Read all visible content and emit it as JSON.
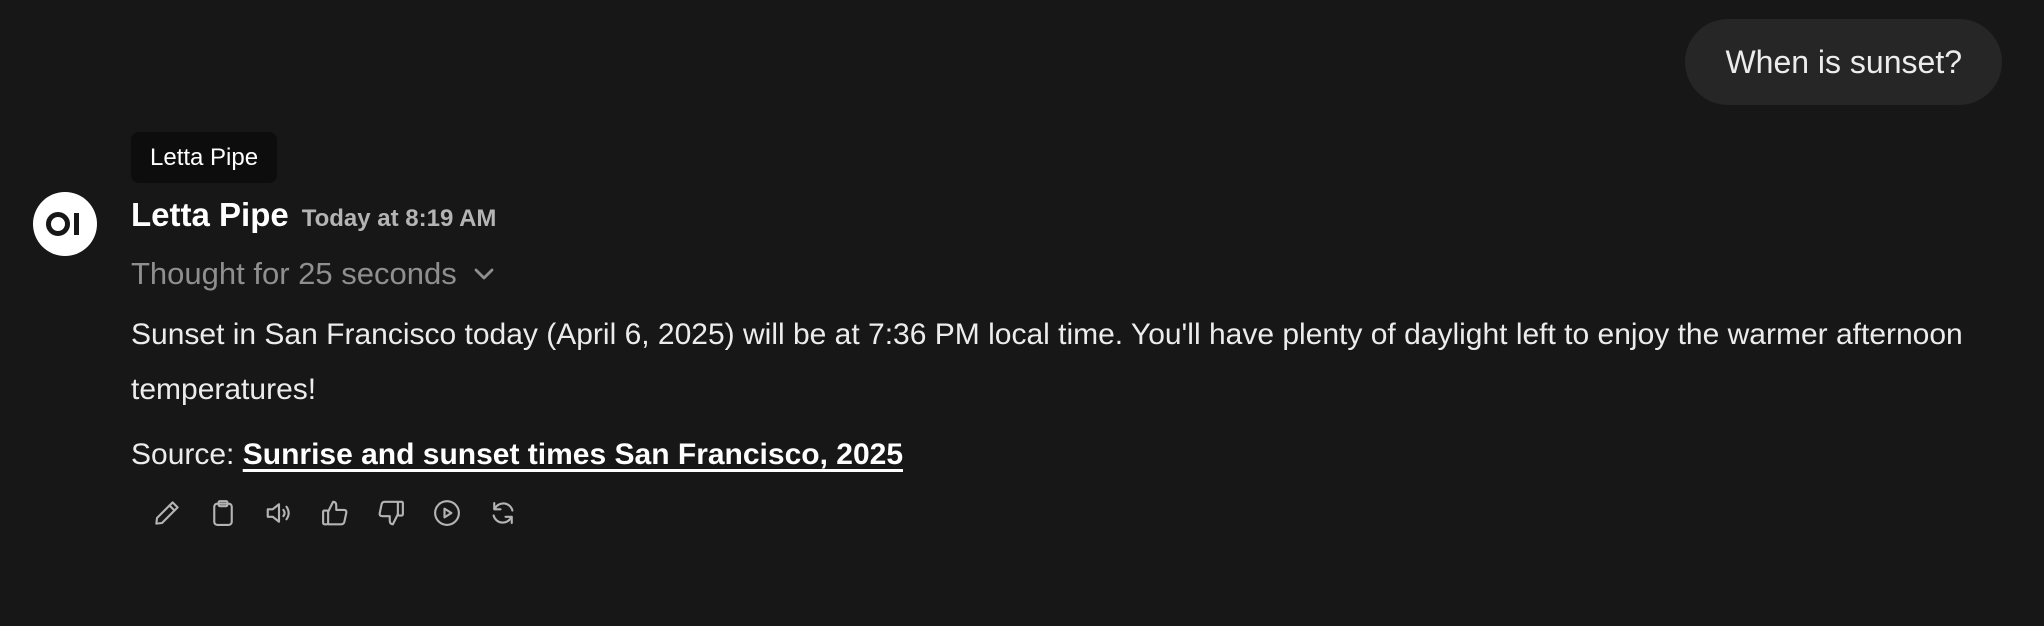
{
  "user_message": {
    "text": "When is sunset?"
  },
  "tooltip": {
    "text": "Letta Pipe"
  },
  "assistant": {
    "avatar_icon": "openwebui-logo-icon",
    "name": "Letta Pipe",
    "timestamp": "Today at 8:19 AM",
    "thought_label": "Thought for 25 seconds",
    "answer": "Sunset in San Francisco today (April 6, 2025) will be at 7:36 PM local time. You'll have plenty of daylight left to enjoy the warmer afternoon temperatures!",
    "source_prefix": "Source: ",
    "source_link": "Sunrise and sunset times San Francisco, 2025"
  },
  "actions": [
    {
      "name": "edit",
      "icon": "pencil-icon"
    },
    {
      "name": "copy",
      "icon": "clipboard-icon"
    },
    {
      "name": "read-aloud",
      "icon": "speaker-icon"
    },
    {
      "name": "good-response",
      "icon": "thumbs-up-icon"
    },
    {
      "name": "bad-response",
      "icon": "thumbs-down-icon"
    },
    {
      "name": "continue",
      "icon": "play-circle-icon"
    },
    {
      "name": "regenerate",
      "icon": "refresh-icon"
    }
  ],
  "colors": {
    "background": "#171717",
    "user_bubble": "#262626",
    "muted_text": "#8f8f8f",
    "icon": "#b4b4b4"
  }
}
